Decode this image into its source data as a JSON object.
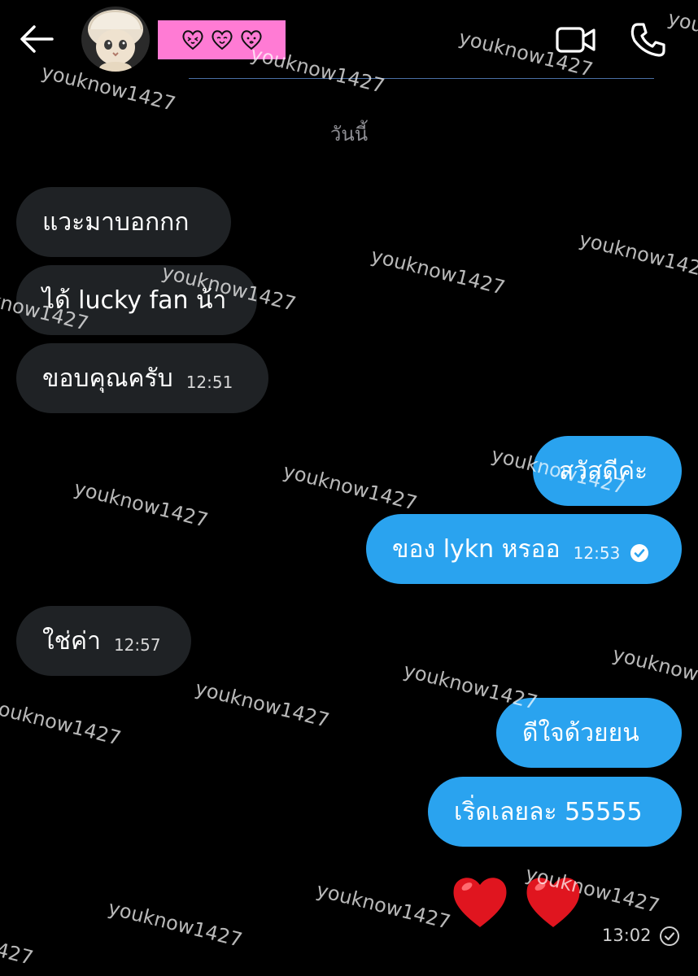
{
  "header": {
    "contact_name_display": "heart-faces",
    "back_icon": "arrow-left-icon",
    "video_icon": "video-camera-icon",
    "phone_icon": "phone-icon"
  },
  "date_label": "วันนี้",
  "messages": [
    {
      "side": "in",
      "text": "แวะมาบอกกก",
      "time": ""
    },
    {
      "side": "in",
      "text": "ได้ lucky fan น้า",
      "time": ""
    },
    {
      "side": "in",
      "text": "ขอบคุณครับ",
      "time": "12:51"
    },
    {
      "side": "out",
      "text": "สวัสดีค่ะ",
      "time": ""
    },
    {
      "side": "out",
      "text": "ของ lykn หรออ",
      "time": "12:53",
      "read": true
    },
    {
      "side": "in",
      "text": "ใช่ค่า",
      "time": "12:57"
    },
    {
      "side": "out",
      "text": "ดีใจด้วยยน",
      "time": ""
    },
    {
      "side": "out",
      "text": "เริ่ดเลยละ 55555",
      "time": ""
    }
  ],
  "reaction": {
    "emoji": "❤️❤️",
    "time": "13:02"
  },
  "watermark": "youknow1427",
  "colors": {
    "outgoing_bubble": "#2aa3ef",
    "incoming_bubble": "#1f2225",
    "name_highlight": "#ff7bd4",
    "background": "#000000"
  }
}
